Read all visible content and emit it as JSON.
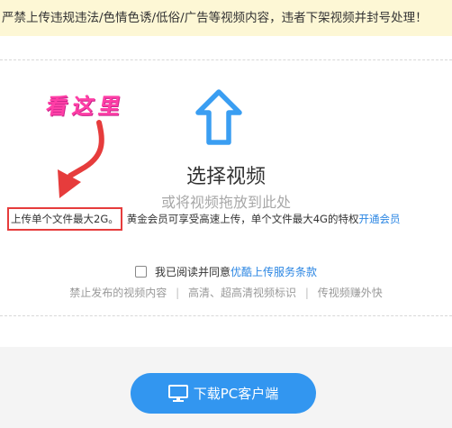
{
  "warning": {
    "text": "严禁上传违规违法/色情色诱/低俗/广告等视频内容，违者下架视频并封号处理！"
  },
  "upload": {
    "icon": "upload-arrow-icon",
    "title": "选择视频",
    "subtitle": "或将视频拖放到此处",
    "limit_text": "上传单个文件最大2G。",
    "member_text": "黄金会员可享受高速上传，单个文件最大4G的特权",
    "member_link": "开通会员"
  },
  "annotation": {
    "text": "看这里",
    "color": "#ff3ea6"
  },
  "agreement": {
    "prefix": "我已阅读并同意",
    "link": "优酷上传服务条款",
    "checked": false
  },
  "rules": {
    "items": [
      "禁止发布的视频内容",
      "高清、超高清视频标识",
      "传视频赚外快"
    ],
    "separator": "|"
  },
  "download": {
    "label": "下载PC客户端",
    "icon": "monitor-icon"
  },
  "colors": {
    "accent": "#2b86e3",
    "button": "#3296f0",
    "highlight_box": "#e63c3c",
    "warning_bg": "#fdf7d5"
  }
}
